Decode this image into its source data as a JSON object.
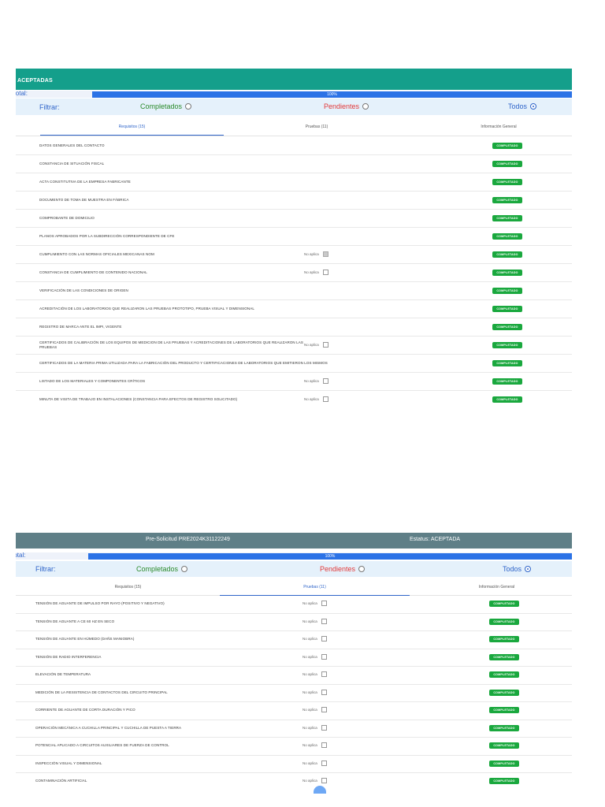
{
  "panel1": {
    "status": "ACEPTADAS",
    "avance_label": "ance total:",
    "progress": {
      "value": 100,
      "label": "100%"
    },
    "filter": {
      "label": "Filtrar:",
      "completados": "Completados",
      "pendientes": "Pendientes",
      "todos": "Todos",
      "selected": "todos"
    },
    "tabs": [
      {
        "label": "Requisitos (15)",
        "active": true
      },
      {
        "label": "Pruebas (11)",
        "active": false
      },
      {
        "label": "Información General",
        "active": false
      }
    ],
    "rows": [
      {
        "label": "DATOS GENERALES DEL CONTACTO",
        "badge": "COMPLETADO"
      },
      {
        "label": "CONSTANCIA DE SITUACIÓN FISCAL",
        "badge": "COMPLETADO"
      },
      {
        "label": "ACTA CONSTITUTIVA DE LA EMPRESA FABRICANTE",
        "badge": "COMPLETADO"
      },
      {
        "label": "DOCUMENTO DE TOMA DE MUESTRA EN FÁBRICA",
        "badge": "COMPLETADO"
      },
      {
        "label": "COMPROBANTE DE DOMICILIO",
        "badge": "COMPLETADO"
      },
      {
        "label": "PLANOS APROBADOS POR LA SUBDIRECCIÓN CORRESPONDIENTE DE CFE",
        "badge": "COMPLETADO"
      },
      {
        "label": "CUMPLIMIENTO CON LAS NORMAS OFICIALES MEXICANAS NOM",
        "noaplica": "No aplica",
        "checked": true,
        "badge": "COMPLETADO"
      },
      {
        "label": "CONSTANCIA DE CUMPLIMIENTO DE CONTENIDO NACIONAL",
        "noaplica": "No aplica",
        "checked": false,
        "badge": "COMPLETADO"
      },
      {
        "label": "VERIFICACIÓN DE LAS CONDICIONES DE ORIGEN",
        "badge": "COMPLETADO"
      },
      {
        "label": "ACREDITACIÓN DE LOS LABORATORIOS QUE REALIZARON LAS PRUEBAS PROTOTIPO, PRUEBA VISUAL Y DIMENSIONAL",
        "badge": "COMPLETADO"
      },
      {
        "label": "REGISTRO DE MARCA ANTE EL IMPI, VIGENTE",
        "badge": "COMPLETADO"
      },
      {
        "label": "CERTIFICADOS DE CALIBRACIÓN DE LOS EQUIPOS DE MEDICION DE LAS PRUEBAS Y ACREDITACIONES DE LABORATORIOS QUE REALIZARON LAS PRUEBAS",
        "noaplica": "No aplica",
        "checked": false,
        "badge": "COMPLETADO"
      },
      {
        "label": "CERTIFICADOS DE LA MATERIA PRIMA UTILIZADA PARA LA FABRICACIÓN DEL PRODUCTO Y CERTIFICACIONES DE LABORATORIOS QUE EMITIERON LOS MISMOS",
        "badge": "COMPLETADO"
      },
      {
        "label": "LISTADO DE LOS MATERIALES Y COMPONENTES CRÍTICOS",
        "noaplica": "No aplica",
        "checked": false,
        "badge": "COMPLETADO"
      },
      {
        "label": "MINUTA DE VISITA DE TRABAJO EN INSTALACIONES (CONSTANCIA PARA EFECTOS DE REGISTRO SOLICITADO)",
        "noaplica": "No aplica",
        "checked": false,
        "badge": "COMPLETADO"
      }
    ]
  },
  "panel2": {
    "title": "Pre-Solicitud PRE2024K31122249",
    "estatus": "Estatus: ACEPTADA",
    "avance_label": "nce total:",
    "progress": {
      "value": 100,
      "label": "100%"
    },
    "filter": {
      "label": "Filtrar:",
      "completados": "Completados",
      "pendientes": "Pendientes",
      "todos": "Todos",
      "selected": "todos"
    },
    "tabs": [
      {
        "label": "Requisitos (15)",
        "active": false
      },
      {
        "label": "Pruebas (11)",
        "active": true
      },
      {
        "label": "Información General",
        "active": false
      }
    ],
    "rows": [
      {
        "label": "TENSIÓN DE AGUANTE DE IMPULSO POR RAYO (POSITIVO Y NEGATIVO)",
        "noaplica": "No aplica",
        "checked": false,
        "badge": "COMPLETADO"
      },
      {
        "label": "TENSIÓN DE AGUANTE A CE 60 Hz EN SECO",
        "noaplica": "No aplica",
        "checked": false,
        "badge": "COMPLETADO"
      },
      {
        "label": "TENSIÓN DE AGUANTE EN HÚMEDO (DAÑS MANIOBRA)",
        "noaplica": "No aplica",
        "checked": false,
        "badge": "COMPLETADO"
      },
      {
        "label": "TENSIÓN DE RADIO INTERFERENCIA",
        "noaplica": "No aplica",
        "checked": false,
        "badge": "COMPLETADO"
      },
      {
        "label": "ELEVACIÓN DE TEMPERATURA",
        "noaplica": "No aplica",
        "checked": false,
        "badge": "COMPLETADO"
      },
      {
        "label": "MEDICIÓN DE LA RESISTENCIA DE CONTACTOS DEL CIRCUITO PRINCIPAL",
        "noaplica": "No aplica",
        "checked": false,
        "badge": "COMPLETADO"
      },
      {
        "label": "CORRIENTE DE AGUANTE DE CORTA DURACIÓN Y PICO",
        "noaplica": "No aplica",
        "checked": false,
        "badge": "COMPLETADO"
      },
      {
        "label": "OPERACIÓN MECÁNICA A CUCHILLA PRINCIPAL Y CUCHILLA DE PUESTA A TIERRA",
        "noaplica": "No aplica",
        "checked": false,
        "badge": "COMPLETADO"
      },
      {
        "label": "POTENCIAL APLICADO A CIRCUITOS AUXILIARES DE FUERZA DE CONTROL",
        "noaplica": "No aplica",
        "checked": false,
        "badge": "COMPLETADO"
      },
      {
        "label": "INSPECCIÓN VISUAL Y DIMENSIONAL",
        "noaplica": "No aplica",
        "checked": false,
        "badge": "COMPLETADO"
      },
      {
        "label": "CONTAMINACIÓN ARTIFICIAL",
        "noaplica": "No aplica",
        "checked": false,
        "badge": "COMPLETADO"
      }
    ]
  }
}
